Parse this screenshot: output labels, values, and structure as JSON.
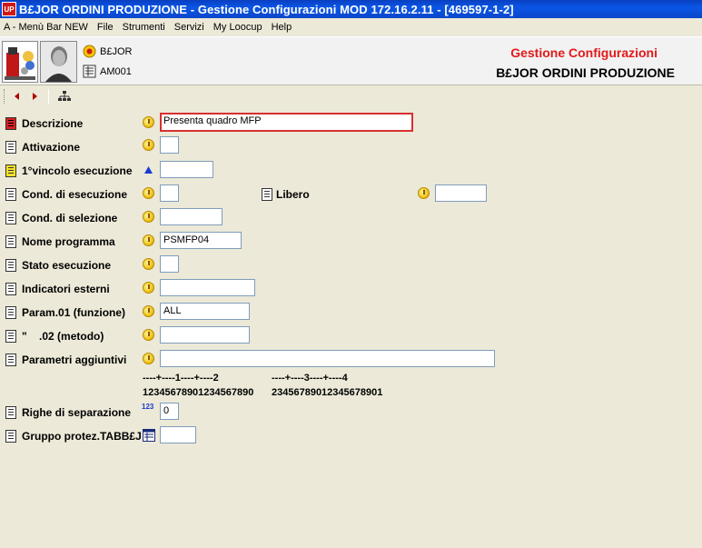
{
  "window": {
    "title": "B£JOR ORDINI PRODUZIONE - Gestione Configurazioni MOD 172.16.2.11 - [469597-1-2]",
    "app_icon_text": "UP"
  },
  "menu": [
    "A - Menù Bar NEW",
    "File",
    "Strumenti",
    "Servizi",
    "My Loocup",
    "Help"
  ],
  "header": {
    "line1": "B£JOR",
    "line2": "AM001",
    "title": "Gestione Configurazioni",
    "subtitle": "B£JOR ORDINI PRODUZIONE",
    "title_color": "#e21a1a"
  },
  "form": {
    "descrizione": {
      "label": "Descrizione",
      "value": "Presenta quadro MFP"
    },
    "attivazione": {
      "label": "Attivazione",
      "value": ""
    },
    "vincolo": {
      "label": "1°vincolo esecuzione",
      "value": ""
    },
    "cond_esecuzione": {
      "label": "Cond. di esecuzione",
      "value": ""
    },
    "libero": {
      "label": "Libero",
      "value": ""
    },
    "cond_selezione": {
      "label": "Cond. di selezione",
      "value": ""
    },
    "nome_programma": {
      "label": "Nome programma",
      "value": "PSMFP04"
    },
    "stato_esecuzione": {
      "label": "Stato esecuzione",
      "value": ""
    },
    "indicatori_esterni": {
      "label": "Indicatori esterni",
      "value": ""
    },
    "param01": {
      "label": "Param.01 (funzione)",
      "value": "ALL"
    },
    "param02": {
      "label": "\"    .02 (metodo)",
      "value": ""
    },
    "parametri_aggiuntivi": {
      "label": "Parametri aggiuntivi",
      "value": ""
    },
    "ruler_top_1": "----+----1----+----2",
    "ruler_top_2": "----+----3----+----4",
    "ruler_bottom_1": "12345678901234567890",
    "ruler_bottom_2": "23456789012345678901",
    "righe": {
      "label": "Righe di separazione",
      "value": "0",
      "icon_text": "123"
    },
    "gruppo": {
      "label": "Gruppo protez.TABB£J",
      "value": ""
    }
  }
}
